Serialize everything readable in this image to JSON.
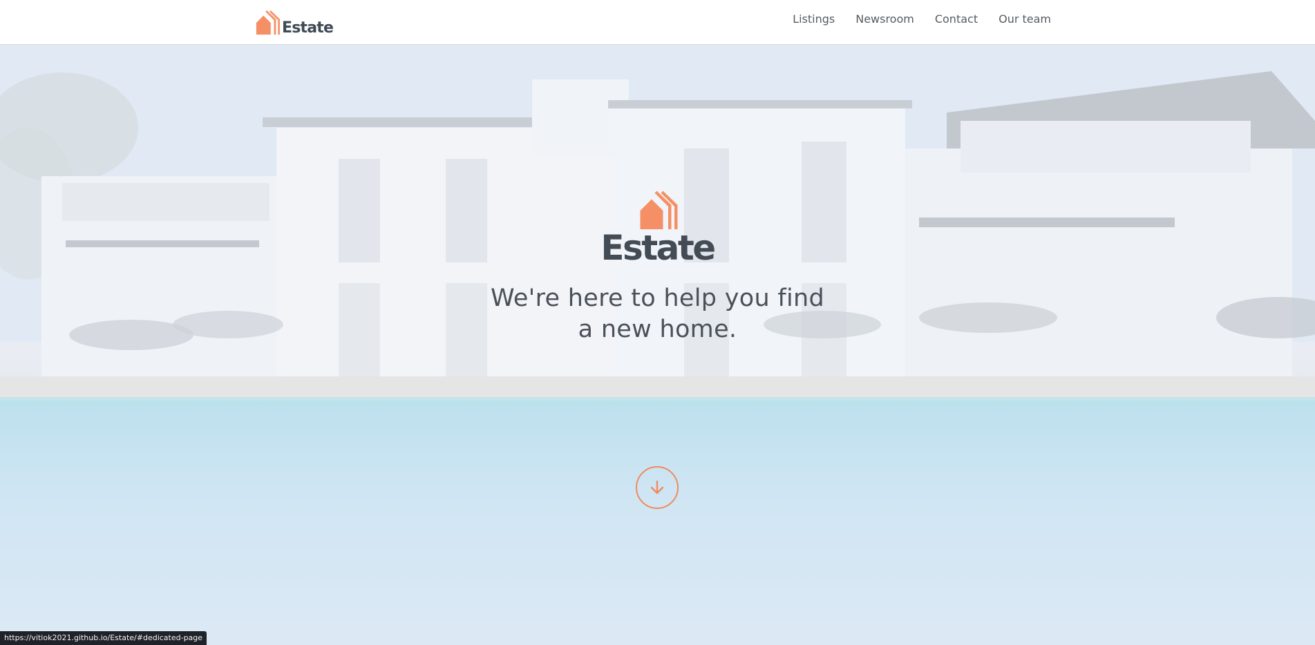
{
  "header": {
    "logo_text": "Estate",
    "nav": [
      {
        "label": "Listings"
      },
      {
        "label": "Newsroom"
      },
      {
        "label": "Contact"
      },
      {
        "label": "Our team"
      }
    ]
  },
  "hero": {
    "logo_text": "Estate",
    "tagline": "We're here to help you find a new home.",
    "scroll_icon": "arrow-down-icon"
  },
  "status_bar": {
    "url": "https://vitiok2021.github.io/Estate/#dedicated-page"
  },
  "colors": {
    "brand_orange": "#f08a5d",
    "logo_text": "#3f4a55",
    "nav_text": "#555b61"
  }
}
